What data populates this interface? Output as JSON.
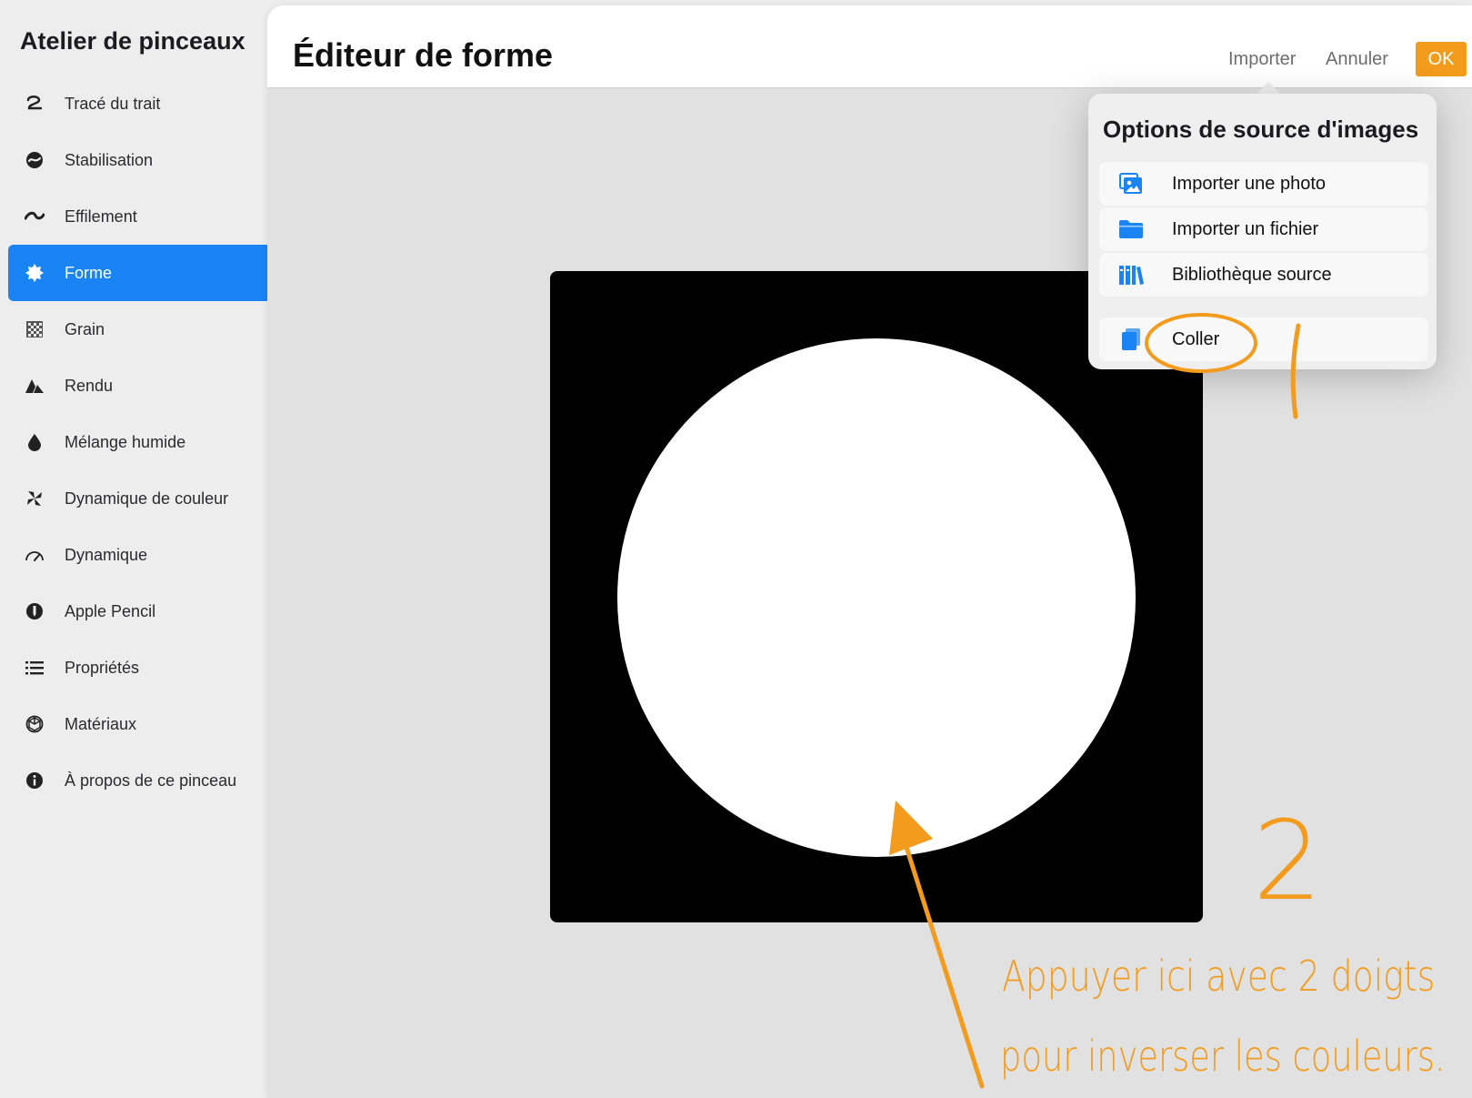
{
  "sidebar": {
    "title": "Atelier de pinceaux",
    "items": [
      {
        "label": "Tracé du trait",
        "icon": "stroke-path-icon"
      },
      {
        "label": "Stabilisation",
        "icon": "stabilization-icon"
      },
      {
        "label": "Effilement",
        "icon": "taper-icon"
      },
      {
        "label": "Forme",
        "icon": "shape-icon",
        "active": true
      },
      {
        "label": "Grain",
        "icon": "grain-icon"
      },
      {
        "label": "Rendu",
        "icon": "rendering-icon"
      },
      {
        "label": "Mélange humide",
        "icon": "wet-mix-icon"
      },
      {
        "label": "Dynamique de couleur",
        "icon": "color-dynamics-icon"
      },
      {
        "label": "Dynamique",
        "icon": "dynamics-icon"
      },
      {
        "label": "Apple Pencil",
        "icon": "apple-pencil-icon"
      },
      {
        "label": "Propriétés",
        "icon": "properties-icon"
      },
      {
        "label": "Matériaux",
        "icon": "materials-icon"
      },
      {
        "label": "À propos de ce pinceau",
        "icon": "about-icon"
      }
    ]
  },
  "header": {
    "title": "Éditeur de forme",
    "import_label": "Importer",
    "cancel_label": "Annuler",
    "ok_label": "OK"
  },
  "popover": {
    "title": "Options de source d'images",
    "items": [
      {
        "label": "Importer une photo",
        "icon": "photo-icon"
      },
      {
        "label": "Importer un fichier",
        "icon": "folder-icon"
      },
      {
        "label": "Bibliothèque source",
        "icon": "library-icon"
      },
      {
        "label": "Coller",
        "icon": "paste-icon"
      }
    ]
  },
  "annotations": {
    "step1": "1",
    "step2": "2",
    "line1": "Appuyer ici avec 2 doigts",
    "line2": "pour inverser les couleurs."
  },
  "colors": {
    "accent": "#1a84f4",
    "ok": "#f29b1d",
    "annotation": "#f29b1d"
  }
}
